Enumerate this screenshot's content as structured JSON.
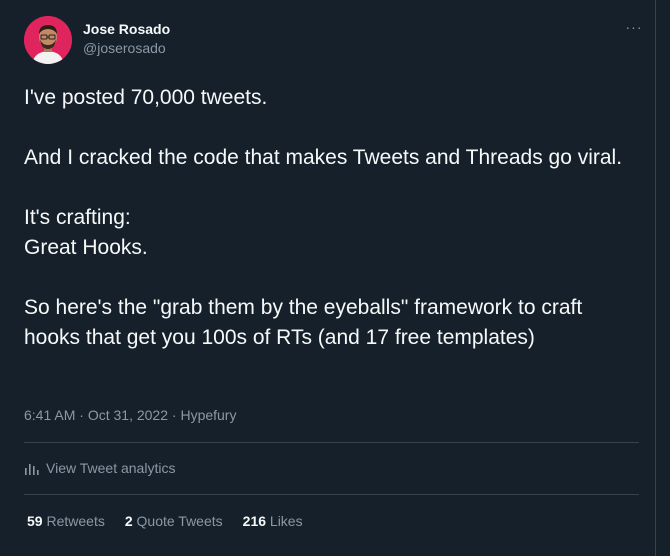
{
  "author": {
    "display_name": "Jose Rosado",
    "handle": "@joserosado"
  },
  "more_menu": "···",
  "tweet": {
    "line1": "I've posted 70,000 tweets.",
    "line2": "And I cracked the code that makes Tweets and Threads go viral.",
    "line3a": "It's crafting:",
    "line3b": "Great Hooks.",
    "line4": "So here's the \"grab them by the eyeballs\" framework to craft hooks that  get you 100s of RTs  (and 17 free templates)"
  },
  "meta": {
    "time": "6:41 AM",
    "separator": " · ",
    "date": "Oct 31, 2022",
    "source": "Hypefury"
  },
  "analytics": {
    "label": "View Tweet analytics",
    "icon": "bar-chart-icon"
  },
  "stats": {
    "retweets_count": "59",
    "retweets_label": "Retweets",
    "quotes_count": "2",
    "quotes_label": "Quote Tweets",
    "likes_count": "216",
    "likes_label": "Likes"
  },
  "colors": {
    "background": "#15202b",
    "primary_text": "#f7f9f9",
    "secondary_text": "#8b98a5",
    "border": "#38444d",
    "avatar_bg": "#e0245e"
  }
}
